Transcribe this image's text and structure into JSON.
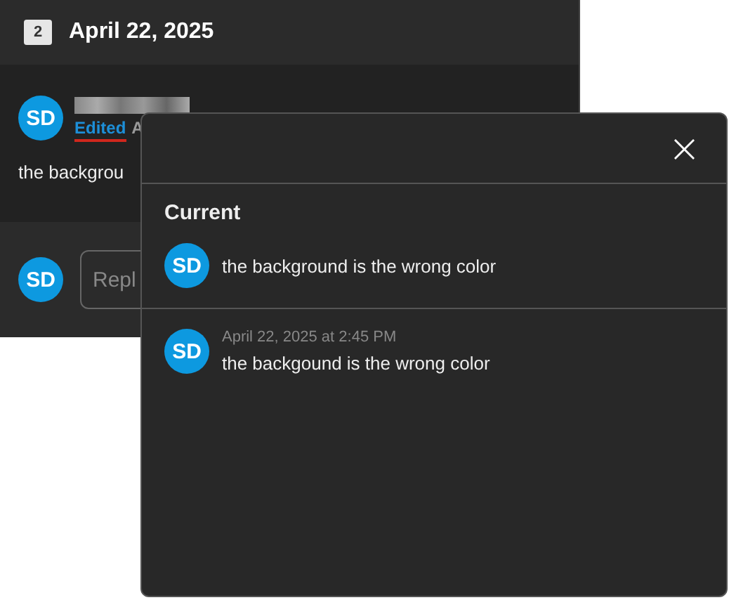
{
  "thread": {
    "number": "2",
    "date": "April 22, 2025"
  },
  "comment": {
    "initials": "SD",
    "edited_label": "Edited",
    "after_label": "A",
    "text": "the backgrou"
  },
  "reply": {
    "initials": "SD",
    "placeholder": "Repl"
  },
  "history_popup": {
    "close": "×",
    "current_heading": "Current",
    "current": {
      "initials": "SD",
      "text": "the background is the wrong color"
    },
    "versions": [
      {
        "initials": "SD",
        "timestamp": "April 22, 2025 at 2:45 PM",
        "text": "the backgound is the wrong color"
      }
    ]
  }
}
